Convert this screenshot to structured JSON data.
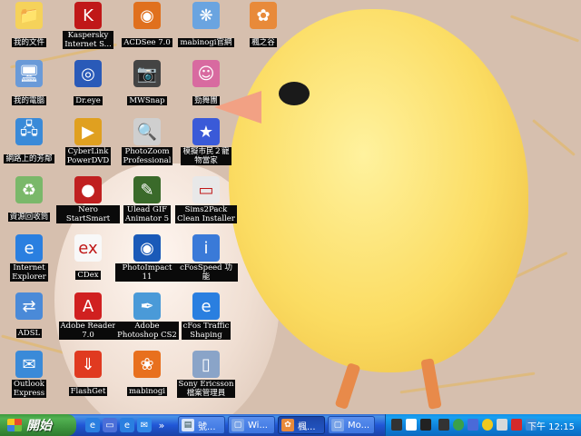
{
  "desktop": {
    "icons": [
      {
        "label": "我的文件",
        "icon": "my-documents-icon"
      },
      {
        "label": "Kaspersky\nInternet S...",
        "icon": "kaspersky-icon"
      },
      {
        "label": "ACDSee 7.0",
        "icon": "acdsee-icon"
      },
      {
        "label": "mabinogi官網",
        "icon": "mabinogi-web-icon"
      },
      {
        "label": "楓之谷",
        "icon": "maplestory-icon"
      },
      {
        "label": "我的電腦",
        "icon": "my-computer-icon"
      },
      {
        "label": "Dr.eye",
        "icon": "dreye-icon"
      },
      {
        "label": "MWSnap",
        "icon": "mwsnap-icon"
      },
      {
        "label": "勁舞團",
        "icon": "audition-icon"
      },
      {
        "label": "網路上的芳鄰",
        "icon": "network-places-icon"
      },
      {
        "label": "CyberLink\nPowerDVD",
        "icon": "powerdvd-icon"
      },
      {
        "label": "PhotoZoom\nProfessional",
        "icon": "photozoom-icon"
      },
      {
        "label": "模擬市民２寵\n物當家",
        "icon": "sims2-pets-icon"
      },
      {
        "label": "資源回收筒",
        "icon": "recycle-bin-icon"
      },
      {
        "label": "Nero StartSmart",
        "icon": "nero-icon"
      },
      {
        "label": "Ulead GIF\nAnimator 5",
        "icon": "ulead-gif-icon"
      },
      {
        "label": "Sims2Pack\nClean Installer",
        "icon": "sims2pack-icon"
      },
      {
        "label": "Internet\nExplorer",
        "icon": "ie-icon"
      },
      {
        "label": "CDex",
        "icon": "cdex-icon"
      },
      {
        "label": "PhotoImpact 11",
        "icon": "photoimpact-icon"
      },
      {
        "label": "cFosSpeed 功能",
        "icon": "cfosspeed-icon"
      },
      {
        "label": "ADSL",
        "icon": "adsl-icon"
      },
      {
        "label": "Adobe Reader\n7.0",
        "icon": "adobe-reader-icon"
      },
      {
        "label": "Adobe\nPhotoshop CS2",
        "icon": "photoshop-icon"
      },
      {
        "label": "cFos Traffic\nShaping",
        "icon": "cfos-traffic-icon"
      },
      {
        "label": "Outlook\nExpress",
        "icon": "outlook-express-icon"
      },
      {
        "label": "FlashGet",
        "icon": "flashget-icon"
      },
      {
        "label": "mabinogi",
        "icon": "mabinogi-icon"
      },
      {
        "label": "Sony Ericsson\n檔案管理員",
        "icon": "sony-ericsson-icon"
      }
    ]
  },
  "taskbar": {
    "start_label": "開始",
    "quick_launch": [
      "ie-icon",
      "desktop-icon",
      "ie-icon",
      "outlook-icon",
      "chevron-icon"
    ],
    "tasks": [
      {
        "label": "號...",
        "icon": "doc-icon"
      },
      {
        "label": "Wi...",
        "icon": "window-icon"
      },
      {
        "label": "楓...",
        "icon": "maplestory-icon",
        "active": true
      },
      {
        "label": "Mo...",
        "icon": "window-icon"
      }
    ],
    "clock": "下午 12:15"
  },
  "colors": {
    "taskbar": "#2157d7",
    "start": "#3a8f3a",
    "tray": "#0e7fd8"
  }
}
